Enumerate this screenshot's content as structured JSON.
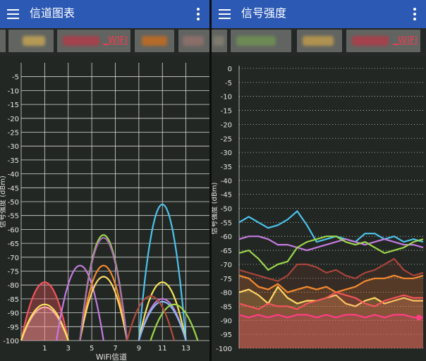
{
  "colors": {
    "appbar": "#2c59b4",
    "chip": "#616461",
    "grid": "#dcdcdc",
    "wifi_label": "#f33d4e"
  },
  "left_panel": {
    "title": "信道图表",
    "menu_icon": "hamburger-menu-icon",
    "more_icon": "overflow-menu-icon",
    "networks": [
      {
        "label": ""
      },
      {
        "label": "_WIFI"
      },
      {
        "label": ""
      },
      {
        "label": ""
      }
    ],
    "chart_data": {
      "type": "area",
      "title": "",
      "xlabel": "WiFi信道",
      "ylabel": "信号强度 (dBm)",
      "ylim": [
        -100,
        0
      ],
      "yticks": [
        -5,
        -10,
        -15,
        -20,
        -25,
        -30,
        -35,
        -40,
        -45,
        -50,
        -55,
        -60,
        -65,
        -70,
        -75,
        -80,
        -85,
        -90,
        -95,
        -100
      ],
      "xticks": [
        1,
        3,
        5,
        7,
        9,
        11,
        13
      ],
      "xlim": [
        -1,
        15
      ],
      "grid": true,
      "series": [
        {
          "color": "#f2545b",
          "channel": 1,
          "peak": -79,
          "fill": true
        },
        {
          "color": "#ffa8a8",
          "channel": 1,
          "peak": -88,
          "fill": true
        },
        {
          "color": "#f7e35a",
          "channel": 1,
          "peak": -87,
          "fill": false
        },
        {
          "color": "#c47ae0",
          "channel": 4,
          "peak": -73,
          "fill": false
        },
        {
          "color": "#9bd64a",
          "channel": 6,
          "peak": -62,
          "fill": false
        },
        {
          "color": "#f38a2f",
          "channel": 6,
          "peak": -73,
          "fill": false
        },
        {
          "color": "#ffd865",
          "channel": 6,
          "peak": -77,
          "fill": false
        },
        {
          "color": "#ab6db3",
          "channel": 6,
          "peak": -63,
          "fill": false
        },
        {
          "color": "#4cc2ec",
          "channel": 11,
          "peak": -51,
          "fill": false
        },
        {
          "color": "#f7e35a",
          "channel": 11,
          "peak": -79,
          "fill": false
        },
        {
          "color": "#c47ae0",
          "channel": 11,
          "peak": -85,
          "fill": false
        },
        {
          "color": "#8ab9f0",
          "channel": 11,
          "peak": -86,
          "fill": false
        },
        {
          "color": "#9bd64a",
          "channel": 12,
          "peak": -87,
          "fill": false
        },
        {
          "color": "#b34a3c",
          "channel": 10,
          "peak": -84,
          "fill": false
        }
      ]
    }
  },
  "right_panel": {
    "title": "信号强度",
    "menu_icon": "hamburger-menu-icon",
    "more_icon": "overflow-menu-icon",
    "networks": [
      {
        "label": ""
      },
      {
        "label": ""
      },
      {
        "label": ""
      },
      {
        "label": "_WIFI"
      }
    ],
    "chart_data": {
      "type": "line",
      "title": "",
      "xlabel": "",
      "ylabel": "信号强度 (dBm)",
      "ylim": [
        -100,
        0
      ],
      "yticks": [
        0,
        -5,
        -10,
        -15,
        -20,
        -25,
        -30,
        -35,
        -40,
        -45,
        -50,
        -55,
        -60,
        -65,
        -70,
        -75,
        -80,
        -85,
        -90,
        -95,
        -100
      ],
      "grid": "horizontal-dashed",
      "series": [
        {
          "color": "#4cc2ec",
          "values": [
            -55,
            -53,
            -55,
            -57,
            -56,
            -54,
            -51,
            -56,
            -62,
            -61,
            -60,
            -61,
            -62,
            -59,
            -59,
            -61,
            -60,
            -62,
            -61,
            -62
          ]
        },
        {
          "color": "#c47ae0",
          "values": [
            -61,
            -60,
            -60,
            -61,
            -63,
            -63,
            -64,
            -65,
            -64,
            -63,
            -62,
            -61,
            -62,
            -63,
            -62,
            -61,
            -62,
            -63,
            -63,
            -64
          ]
        },
        {
          "color": "#9bd64a",
          "values": [
            -66,
            -65,
            -68,
            -72,
            -70,
            -69,
            -64,
            -62,
            -61,
            -60,
            -60,
            -62,
            -63,
            -62,
            -64,
            -66,
            -65,
            -64,
            -62,
            -61
          ]
        },
        {
          "color": "#a8443a",
          "values": [
            -72,
            -73,
            -74,
            -75,
            -76,
            -74,
            -70,
            -70,
            -71,
            -73,
            -72,
            -74,
            -75,
            -73,
            -72,
            -70,
            -68,
            -72,
            -74,
            -73
          ]
        },
        {
          "color": "#f38a2f",
          "values": [
            -74,
            -75,
            -78,
            -79,
            -77,
            -80,
            -79,
            -78,
            -79,
            -78,
            -80,
            -79,
            -78,
            -76,
            -75,
            -75,
            -74,
            -75,
            -75,
            -74
          ]
        },
        {
          "color": "#ffd865",
          "values": [
            -80,
            -79,
            -81,
            -84,
            -78,
            -82,
            -84,
            -83,
            -83,
            -82,
            -81,
            -84,
            -85,
            -83,
            -82,
            -84,
            -83,
            -82,
            -83,
            -83
          ]
        },
        {
          "color": "#f2545b",
          "values": [
            -84,
            -85,
            -86,
            -84,
            -85,
            -85,
            -86,
            -84,
            -83,
            -82,
            -80,
            -81,
            -82,
            -84,
            -85,
            -83,
            -82,
            -81,
            -82,
            -82
          ]
        },
        {
          "color": "#ff3e86",
          "values": [
            -88,
            -89,
            -88,
            -89,
            -88,
            -89,
            -88,
            -88,
            -89,
            -88,
            -89,
            -88,
            -88,
            -89,
            -88,
            -89,
            -88,
            -88,
            -89,
            -89
          ]
        }
      ]
    }
  }
}
